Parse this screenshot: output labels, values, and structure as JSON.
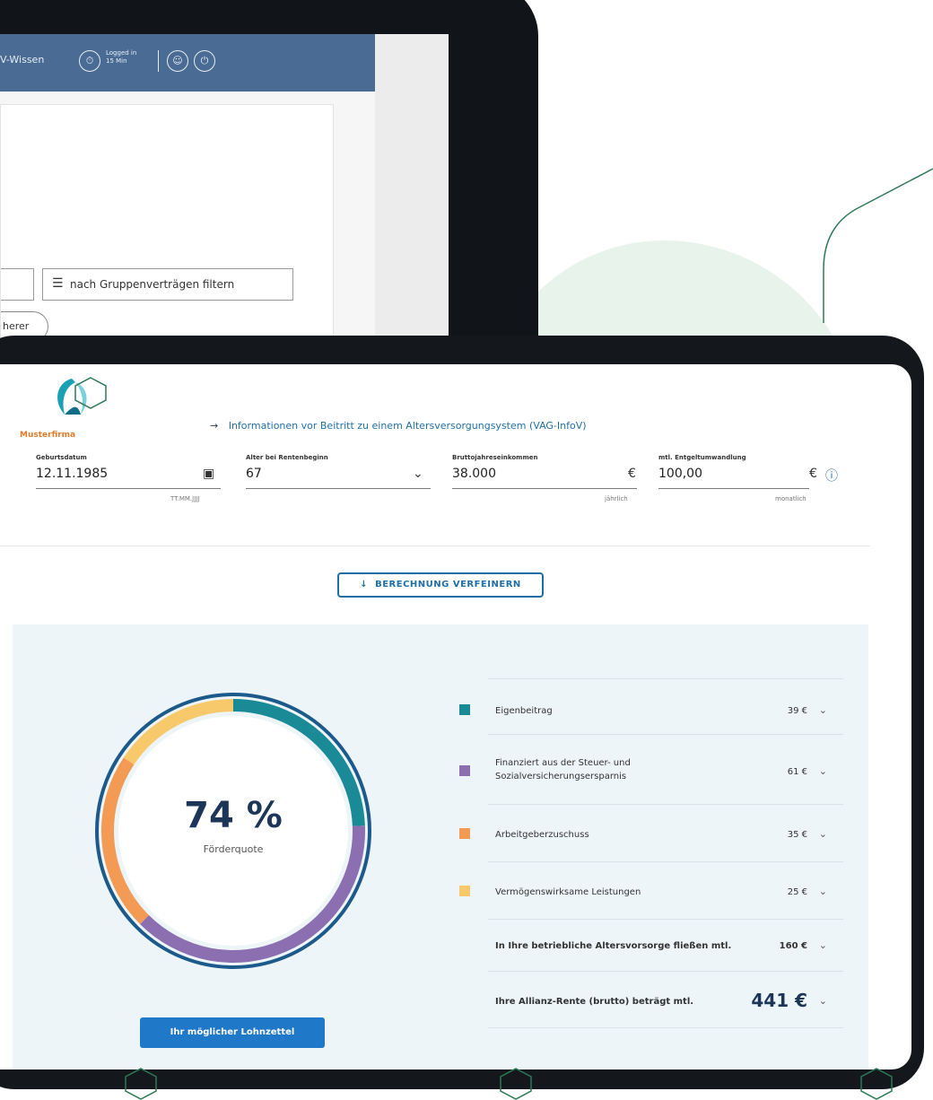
{
  "laptop": {
    "header_link": "V-Wissen",
    "login_status": "Logged in 15 Min",
    "filter_label": "nach Gruppenverträgen filtern",
    "pill_label": "herer"
  },
  "tablet": {
    "brand": "Musterfirma",
    "info_link": "Informationen vor Beitritt zu einem Altersversorgungsystem (VAG-InfoV)",
    "fields": [
      {
        "label": "Geburtsdatum",
        "value": "12.11.1985",
        "hint": "TT.MM.JJJJ",
        "icon": "calendar-icon"
      },
      {
        "label": "Alter bei Rentenbeginn",
        "value": "67",
        "icon": "chevron-down-icon"
      },
      {
        "label": "Bruttojahreseinkommen",
        "value": "38.000",
        "unit": "€",
        "hint": "jährlich"
      },
      {
        "label": "mtl. Entgeltumwandlung",
        "value": "100,00",
        "unit": "€",
        "hint": "monatlich",
        "icon": "info-icon"
      }
    ],
    "refine_button": "BERECHNUNG VERFEINERN",
    "donut": {
      "percent": "74 %",
      "label": "Förderquote",
      "segments": [
        {
          "name": "Eigenbeitrag",
          "value": 39,
          "color": "#1a8a96"
        },
        {
          "name": "Finanziert aus der Steuer- und Sozialversicherungsersparnis",
          "value": 61,
          "color": "#8b6fb0"
        },
        {
          "name": "Arbeitgeberzuschuss",
          "value": 35,
          "color": "#f39a55"
        },
        {
          "name": "Vermögenswirksame Leistungen",
          "value": 25,
          "color": "#f7c96a"
        }
      ],
      "ring_color": "#1d5a8c"
    },
    "payslip_button": "Ihr möglicher Lohnzettel",
    "legend": [
      {
        "label": "Eigenbeitrag",
        "amount": "39 €",
        "color": "#1a8a96"
      },
      {
        "label": "Finanziert aus der Steuer- und Sozialversicherungsersparnis",
        "amount": "61 €",
        "color": "#8b6fb0"
      },
      {
        "label": "Arbeitgeberzuschuss",
        "amount": "35 €",
        "color": "#f39a55"
      },
      {
        "label": "Vermögenswirksame Leistungen",
        "amount": "25 €",
        "color": "#f7c96a"
      }
    ],
    "total_row": {
      "label": "In Ihre betriebliche Altersvorsorge fließen mtl.",
      "amount": "160 €"
    },
    "pension_row": {
      "label": "Ihre Allianz-Rente (brutto) beträgt mtl.",
      "amount": "441 €"
    }
  }
}
